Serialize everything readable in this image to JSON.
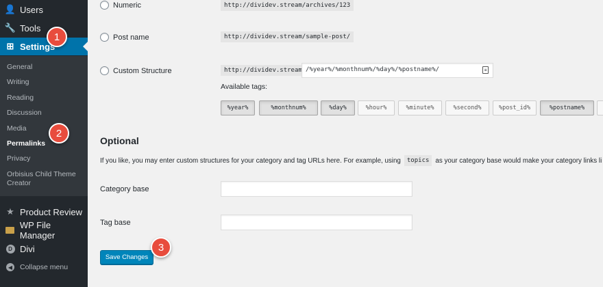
{
  "sidebar": {
    "users": "Users",
    "tools": "Tools",
    "settings": "Settings",
    "submenu": [
      "General",
      "Writing",
      "Reading",
      "Discussion",
      "Media",
      "Permalinks",
      "Privacy",
      "Orbisius Child Theme",
      "Creator"
    ],
    "product_review": "Product Review",
    "wp_file_manager": "WP File Manager",
    "divi": "Divi",
    "collapse": "Collapse menu",
    "divi_icon_letter": "D"
  },
  "permalinks": {
    "numeric": {
      "label": "Numeric",
      "example": "http://dividev.stream/archives/123"
    },
    "post_name": {
      "label": "Post name",
      "example": "http://dividev.stream/sample-post/"
    },
    "custom": {
      "label": "Custom Structure",
      "prefix": "http://dividev.stream",
      "value": "/%year%/%monthnum%/%day%/%postname%/"
    },
    "available_tags_label": "Available tags:",
    "tags": [
      "%year%",
      "%monthnum%",
      "%day%",
      "%hour%",
      "%minute%",
      "%second%",
      "%post_id%",
      "%postname%"
    ],
    "active_tags": [
      "%year%",
      "%monthnum%",
      "%day%",
      "%postname%"
    ]
  },
  "optional": {
    "title": "Optional",
    "desc_before": "If you like, you may enter custom structures for your category and tag URLs here. For example, using",
    "desc_code": "topics",
    "desc_after": "as your category base would make your category links li",
    "category_base_label": "Category base",
    "category_base_value": "",
    "tag_base_label": "Tag base",
    "tag_base_value": ""
  },
  "save_label": "Save Changes",
  "badges": [
    "1",
    "2",
    "3"
  ],
  "colors": {
    "sidebar_bg": "#23282d",
    "submenu_bg": "#32373c",
    "active_bg": "#0073aa",
    "save_bg": "#0085ba",
    "badge_bg": "#e84c3d"
  }
}
